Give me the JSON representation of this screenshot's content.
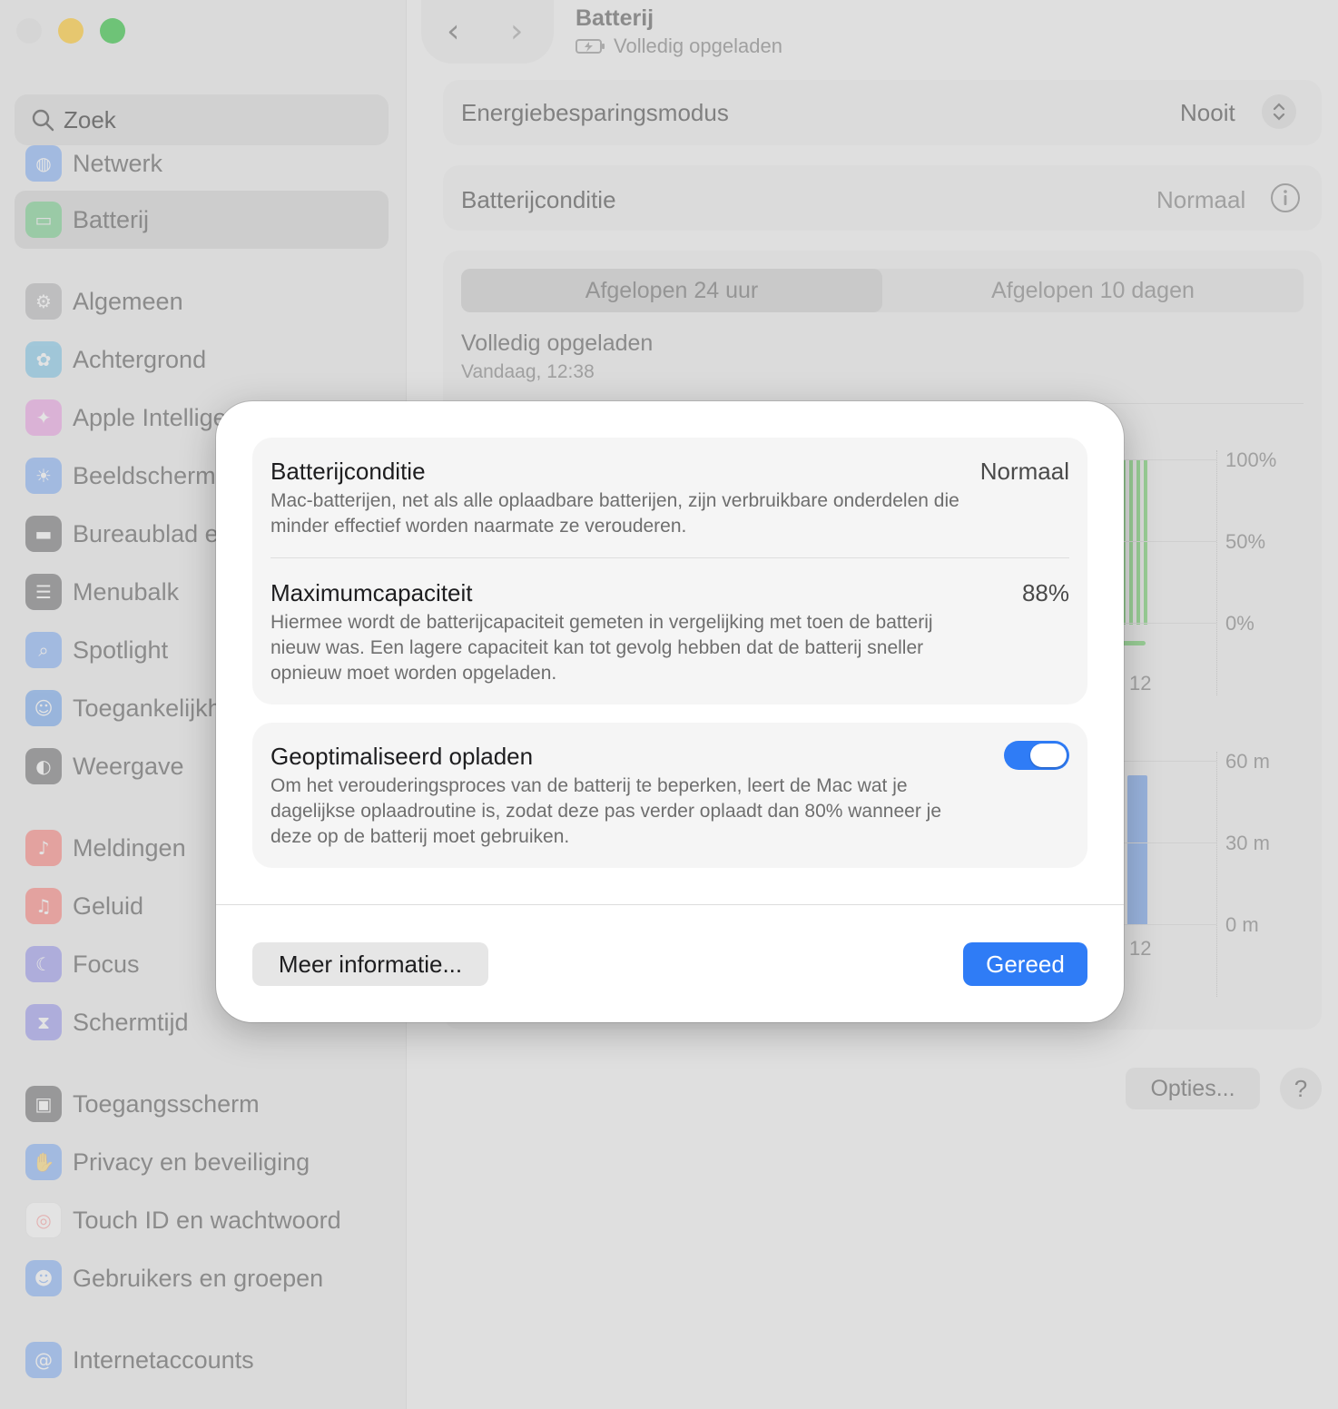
{
  "window": {
    "title": "Batterij",
    "subtitle": "Volledig opgeladen"
  },
  "sidebar": {
    "search_placeholder": "Zoek",
    "items": [
      {
        "label": "Netwerk",
        "icon": "globe-icon",
        "color": "#3b82f6"
      },
      {
        "label": "Batterij",
        "icon": "battery-icon",
        "color": "#34c759",
        "selected": true
      },
      {
        "label": "Algemeen",
        "icon": "gear-icon",
        "color": "#8e8e93"
      },
      {
        "label": "Achtergrond",
        "icon": "flower-icon",
        "color": "#35a8e0"
      },
      {
        "label": "Apple Intellige",
        "icon": "sparkle-icon",
        "color": "#e56bd8"
      },
      {
        "label": "Beeldscherm",
        "icon": "sun-icon",
        "color": "#3b82f6"
      },
      {
        "label": "Bureaublad e",
        "icon": "dock-icon",
        "color": "#1c1c1e"
      },
      {
        "label": "Menubalk",
        "icon": "menubar-icon",
        "color": "#1c1c1e"
      },
      {
        "label": "Spotlight",
        "icon": "magnifier-icon",
        "color": "#3b82f6"
      },
      {
        "label": "Toegankelijkh",
        "icon": "accessibility-icon",
        "color": "#1e73e8"
      },
      {
        "label": "Weergave",
        "icon": "appearance-icon",
        "color": "#1c1c1e"
      },
      {
        "label": "Meldingen",
        "icon": "bell-icon",
        "color": "#ff3b30"
      },
      {
        "label": "Geluid",
        "icon": "speaker-icon",
        "color": "#ff3b30"
      },
      {
        "label": "Focus",
        "icon": "moon-icon",
        "color": "#5e5ce6"
      },
      {
        "label": "Schermtijd",
        "icon": "hourglass-icon",
        "color": "#5e5ce6"
      },
      {
        "label": "Toegangsscherm",
        "icon": "lock-icon",
        "color": "#1c1c1e"
      },
      {
        "label": "Privacy en beveiliging",
        "icon": "hand-icon",
        "color": "#3b82f6"
      },
      {
        "label": "Touch ID en wachtwoord",
        "icon": "fingerprint-icon",
        "color": "#ffffff"
      },
      {
        "label": "Gebruikers en groepen",
        "icon": "users-icon",
        "color": "#3b82f6"
      },
      {
        "label": "Internetaccounts",
        "icon": "at-icon",
        "color": "#3b82f6"
      }
    ]
  },
  "main": {
    "energy_label": "Energiebesparingsmodus",
    "energy_value": "Nooit",
    "condition_label": "Batterijconditie",
    "condition_value": "Normaal",
    "tab_24h": "Afgelopen 24 uur",
    "tab_10d": "Afgelopen 10 dagen",
    "charge_status": "Volledig opgeladen",
    "charge_time": "Vandaag, 12:38",
    "level_axis": [
      "100%",
      "50%",
      "0%"
    ],
    "level_x_label": "12",
    "usage_axis": [
      "60 m",
      "30 m",
      "0 m"
    ],
    "usage_x_label": "12",
    "options_button": "Opties...",
    "help_button": "?"
  },
  "sheet": {
    "condition_title": "Batterijconditie",
    "condition_value": "Normaal",
    "condition_desc": "Mac-batterijen, net als alle oplaadbare batterijen, zijn verbruikbare onderdelen die minder effectief worden naarmate ze verouderen.",
    "capacity_title": "Maximumcapaciteit",
    "capacity_value": "88%",
    "capacity_desc": "Hiermee wordt de batterijcapaciteit gemeten in vergelijking met toen de batterij nieuw was. Een lagere capaciteit kan tot gevolg hebben dat de batterij sneller opnieuw moet worden opgeladen.",
    "optimized_title": "Geoptimaliseerd opladen",
    "optimized_on": true,
    "optimized_desc": "Om het verouderingsproces van de batterij te beperken, leert de Mac wat je dagelijkse oplaadroutine is, zodat deze pas verder oplaadt dan 80% wanneer je deze op de batterij moet gebruiken.",
    "more_info_button": "Meer informatie...",
    "done_button": "Gereed"
  },
  "colors": {
    "accent": "#2f7cf6",
    "battery_green": "#7fcf7a",
    "usage_blue": "#7ea6e6",
    "traffic_yellow": "#f6c640",
    "traffic_green": "#3ec04c"
  }
}
